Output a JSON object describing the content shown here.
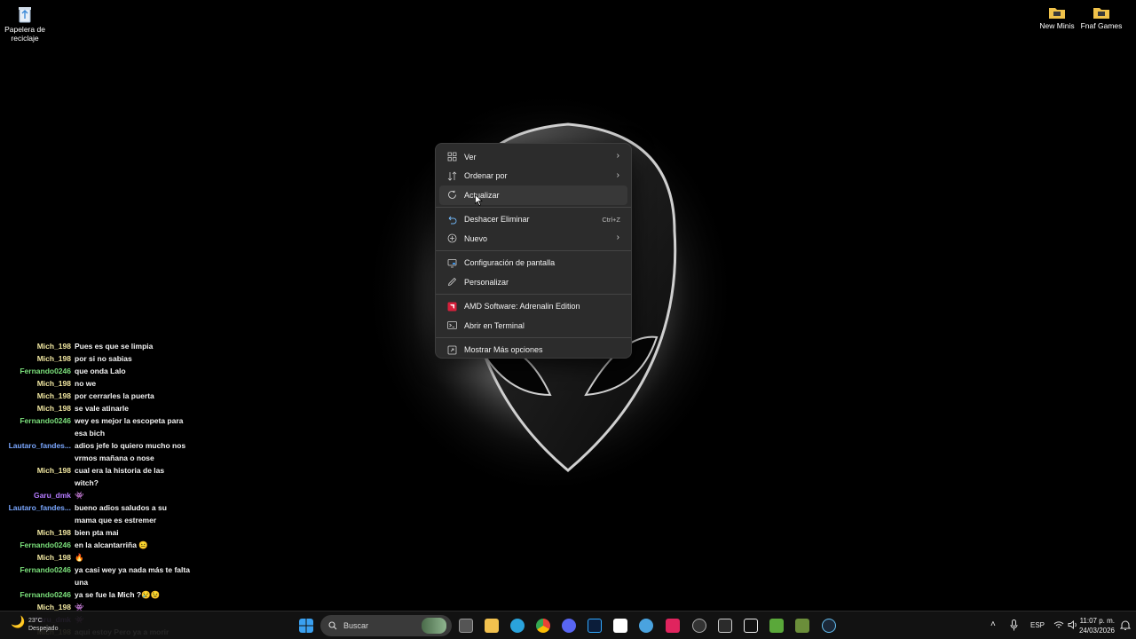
{
  "desktop": {
    "icons_left": [
      {
        "label": "Papelera de reciclaje",
        "icon": "recycle-bin-icon"
      }
    ],
    "icons_right": [
      {
        "label": "New Minis",
        "icon": "folder-icon"
      },
      {
        "label": "Fnaf Games",
        "icon": "folder-icon"
      }
    ]
  },
  "context_menu": {
    "items": [
      {
        "label": "Ver",
        "icon": "grid-icon",
        "submenu": true
      },
      {
        "label": "Ordenar por",
        "icon": "sort-icon",
        "submenu": true
      },
      {
        "label": "Actualizar",
        "icon": "refresh-icon",
        "hovered": true
      },
      {
        "label": "Deshacer Eliminar",
        "icon": "undo-icon",
        "shortcut": "Ctrl+Z"
      },
      {
        "label": "Nuevo",
        "icon": "plus-circle-icon",
        "submenu": true
      },
      {
        "label": "Configuración de pantalla",
        "icon": "display-icon"
      },
      {
        "label": "Personalizar",
        "icon": "pen-icon"
      },
      {
        "label": "AMD Software: Adrenalin Edition",
        "icon": "amd-icon"
      },
      {
        "label": "Abrir en Terminal",
        "icon": "terminal-icon"
      },
      {
        "label": "Mostrar Más opciones",
        "icon": "more-options-icon"
      }
    ],
    "submenu_glyph": "›"
  },
  "chat": {
    "colors": {
      "Mich_198": "#f0e6a0",
      "Fernando0246": "#7be07b",
      "Lautaro_fandes...": "#7aa7ff",
      "Garu_dmk": "#b57bff"
    },
    "messages": [
      {
        "user": "Mich_198",
        "text": "Pues es que se limpia"
      },
      {
        "user": "Mich_198",
        "text": "por si no sabias"
      },
      {
        "user": "Fernando0246",
        "text": "que onda Lalo"
      },
      {
        "user": "Mich_198",
        "text": "no we"
      },
      {
        "user": "Mich_198",
        "text": "por cerrarles la puerta"
      },
      {
        "user": "Mich_198",
        "text": "se vale atinarle"
      },
      {
        "user": "Fernando0246",
        "text": "wey es mejor la escopeta para esa bich"
      },
      {
        "user": "Lautaro_fandes...",
        "text": "adios jefe lo quiero mucho nos vrmos mañana o nose"
      },
      {
        "user": "Mich_198",
        "text": "cual era la historia de las witch?"
      },
      {
        "user": "Garu_dmk",
        "text": "👾"
      },
      {
        "user": "Lautaro_fandes...",
        "text": "bueno adios saludos a su mama que es estremer"
      },
      {
        "user": "Mich_198",
        "text": "bien pta mai"
      },
      {
        "user": "Fernando0246",
        "text": "en la alcantarriña 😐"
      },
      {
        "user": "Mich_198",
        "text": "🔥"
      },
      {
        "user": "Fernando0246",
        "text": "ya casi wey ya nada más te falta una"
      },
      {
        "user": "Fernando0246",
        "text": "ya se fue la Mich ?😢😉"
      },
      {
        "user": "Mich_198",
        "text": "👾"
      },
      {
        "user": "Garu_dmk",
        "text": "👾"
      },
      {
        "user": "Mich_198",
        "text": "aqui estoy Pero ya a morir"
      }
    ]
  },
  "taskbar": {
    "search_placeholder": "Buscar",
    "weather_top": "23°C",
    "weather_bottom": "Despejado",
    "language": "ESP",
    "time": "11:07 p. m.",
    "date": "24/03/2026",
    "apps": [
      "start-icon",
      "search-icon",
      "task-view-icon",
      "file-explorer-icon",
      "telegram-icon",
      "chrome-icon",
      "discord-icon",
      "photoshop-icon",
      "capcut-icon",
      "app-icon",
      "tiktok-icon",
      "steam-overlay-icon",
      "epic-games-icon",
      "capcut-pro-icon",
      "minecraft-icon",
      "minecraft-launcher-icon",
      "steam-icon"
    ]
  }
}
